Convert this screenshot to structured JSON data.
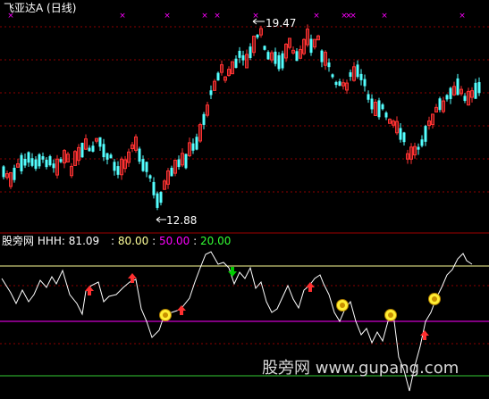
{
  "main_panel": {
    "title": "飞亚达A",
    "period": "(日线)",
    "high_label": "19.47",
    "low_label": "12.88",
    "colors": {
      "up": "#ff3232",
      "down": "#54ffff",
      "marker": "#ff00ff",
      "grid": "#8b0000"
    }
  },
  "indicator_panel": {
    "source": "股旁网",
    "name": "HHH:",
    "value": "81.09",
    "levels": [
      {
        "value": "80.00",
        "color": "#ffff99"
      },
      {
        "value": "50.00",
        "color": "#ff00ff"
      },
      {
        "value": "20.00",
        "color": "#33cc33"
      }
    ],
    "line_color": "#ffffff",
    "signal_colors": {
      "buy": "#ff3030",
      "sell": "#00cc00",
      "coin": "#ffee33"
    }
  },
  "watermark": "股旁网 www.gupang.com"
}
